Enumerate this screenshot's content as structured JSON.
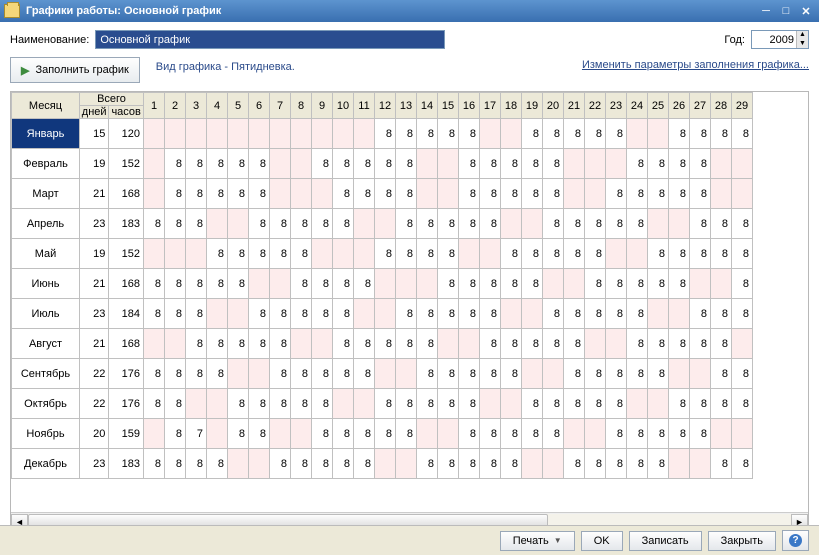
{
  "title": "Графики работы: Основной график",
  "labels": {
    "naimen": "Наименование:",
    "year": "Год:",
    "fill": "Заполнить график",
    "vid": "Вид графика - Пятидневка.",
    "link": "Изменить параметры заполнения графика...",
    "month": "Месяц",
    "total": "Всего",
    "days": "дней",
    "hours": "часов",
    "print": "Печать",
    "ok": "OK",
    "save": "Записать",
    "close": "Закрыть"
  },
  "form": {
    "name": "Основной график",
    "year": "2009"
  },
  "days_header_count": 29,
  "months": [
    {
      "name": "Январь",
      "days": 15,
      "hours": 120,
      "sel": true,
      "cells": [
        null,
        null,
        null,
        null,
        null,
        null,
        null,
        null,
        null,
        null,
        null,
        8,
        8,
        8,
        8,
        8,
        null,
        null,
        8,
        8,
        8,
        8,
        8,
        null,
        null,
        8,
        8,
        8,
        8
      ]
    },
    {
      "name": "Февраль",
      "days": 19,
      "hours": 152,
      "cells": [
        null,
        8,
        8,
        8,
        8,
        8,
        null,
        null,
        8,
        8,
        8,
        8,
        8,
        null,
        null,
        8,
        8,
        8,
        8,
        8,
        null,
        null,
        null,
        8,
        8,
        8,
        8,
        null,
        null
      ]
    },
    {
      "name": "Март",
      "days": 21,
      "hours": 168,
      "cells": [
        null,
        8,
        8,
        8,
        8,
        8,
        null,
        null,
        null,
        8,
        8,
        8,
        8,
        null,
        null,
        8,
        8,
        8,
        8,
        8,
        null,
        null,
        8,
        8,
        8,
        8,
        8,
        null,
        null
      ]
    },
    {
      "name": "Апрель",
      "days": 23,
      "hours": 183,
      "cells": [
        8,
        8,
        8,
        null,
        null,
        8,
        8,
        8,
        8,
        8,
        null,
        null,
        8,
        8,
        8,
        8,
        8,
        null,
        null,
        8,
        8,
        8,
        8,
        8,
        null,
        null,
        8,
        8,
        8
      ]
    },
    {
      "name": "Май",
      "days": 19,
      "hours": 152,
      "cells": [
        null,
        null,
        null,
        8,
        8,
        8,
        8,
        8,
        null,
        null,
        null,
        8,
        8,
        8,
        8,
        null,
        null,
        8,
        8,
        8,
        8,
        8,
        null,
        null,
        8,
        8,
        8,
        8,
        8
      ]
    },
    {
      "name": "Июнь",
      "days": 21,
      "hours": 168,
      "cells": [
        8,
        8,
        8,
        8,
        8,
        null,
        null,
        8,
        8,
        8,
        8,
        null,
        null,
        null,
        8,
        8,
        8,
        8,
        8,
        null,
        null,
        8,
        8,
        8,
        8,
        8,
        null,
        null,
        8
      ]
    },
    {
      "name": "Июль",
      "days": 23,
      "hours": 184,
      "cells": [
        8,
        8,
        8,
        null,
        null,
        8,
        8,
        8,
        8,
        8,
        null,
        null,
        8,
        8,
        8,
        8,
        8,
        null,
        null,
        8,
        8,
        8,
        8,
        8,
        null,
        null,
        8,
        8,
        8
      ]
    },
    {
      "name": "Август",
      "days": 21,
      "hours": 168,
      "cells": [
        null,
        null,
        8,
        8,
        8,
        8,
        8,
        null,
        null,
        8,
        8,
        8,
        8,
        8,
        null,
        null,
        8,
        8,
        8,
        8,
        8,
        null,
        null,
        8,
        8,
        8,
        8,
        8,
        null
      ]
    },
    {
      "name": "Сентябрь",
      "days": 22,
      "hours": 176,
      "cells": [
        8,
        8,
        8,
        8,
        null,
        null,
        8,
        8,
        8,
        8,
        8,
        null,
        null,
        8,
        8,
        8,
        8,
        8,
        null,
        null,
        8,
        8,
        8,
        8,
        8,
        null,
        null,
        8,
        8
      ]
    },
    {
      "name": "Октябрь",
      "days": 22,
      "hours": 176,
      "cells": [
        8,
        8,
        null,
        null,
        8,
        8,
        8,
        8,
        8,
        null,
        null,
        8,
        8,
        8,
        8,
        8,
        null,
        null,
        8,
        8,
        8,
        8,
        8,
        null,
        null,
        8,
        8,
        8,
        8
      ]
    },
    {
      "name": "Ноябрь",
      "days": 20,
      "hours": 159,
      "cells": [
        null,
        8,
        7,
        null,
        8,
        8,
        null,
        null,
        8,
        8,
        8,
        8,
        8,
        null,
        null,
        8,
        8,
        8,
        8,
        8,
        null,
        null,
        8,
        8,
        8,
        8,
        8,
        null,
        null
      ]
    },
    {
      "name": "Декабрь",
      "days": 23,
      "hours": 183,
      "cells": [
        8,
        8,
        8,
        8,
        null,
        null,
        8,
        8,
        8,
        8,
        8,
        null,
        null,
        8,
        8,
        8,
        8,
        8,
        null,
        null,
        8,
        8,
        8,
        8,
        8,
        null,
        null,
        8,
        8
      ]
    }
  ]
}
